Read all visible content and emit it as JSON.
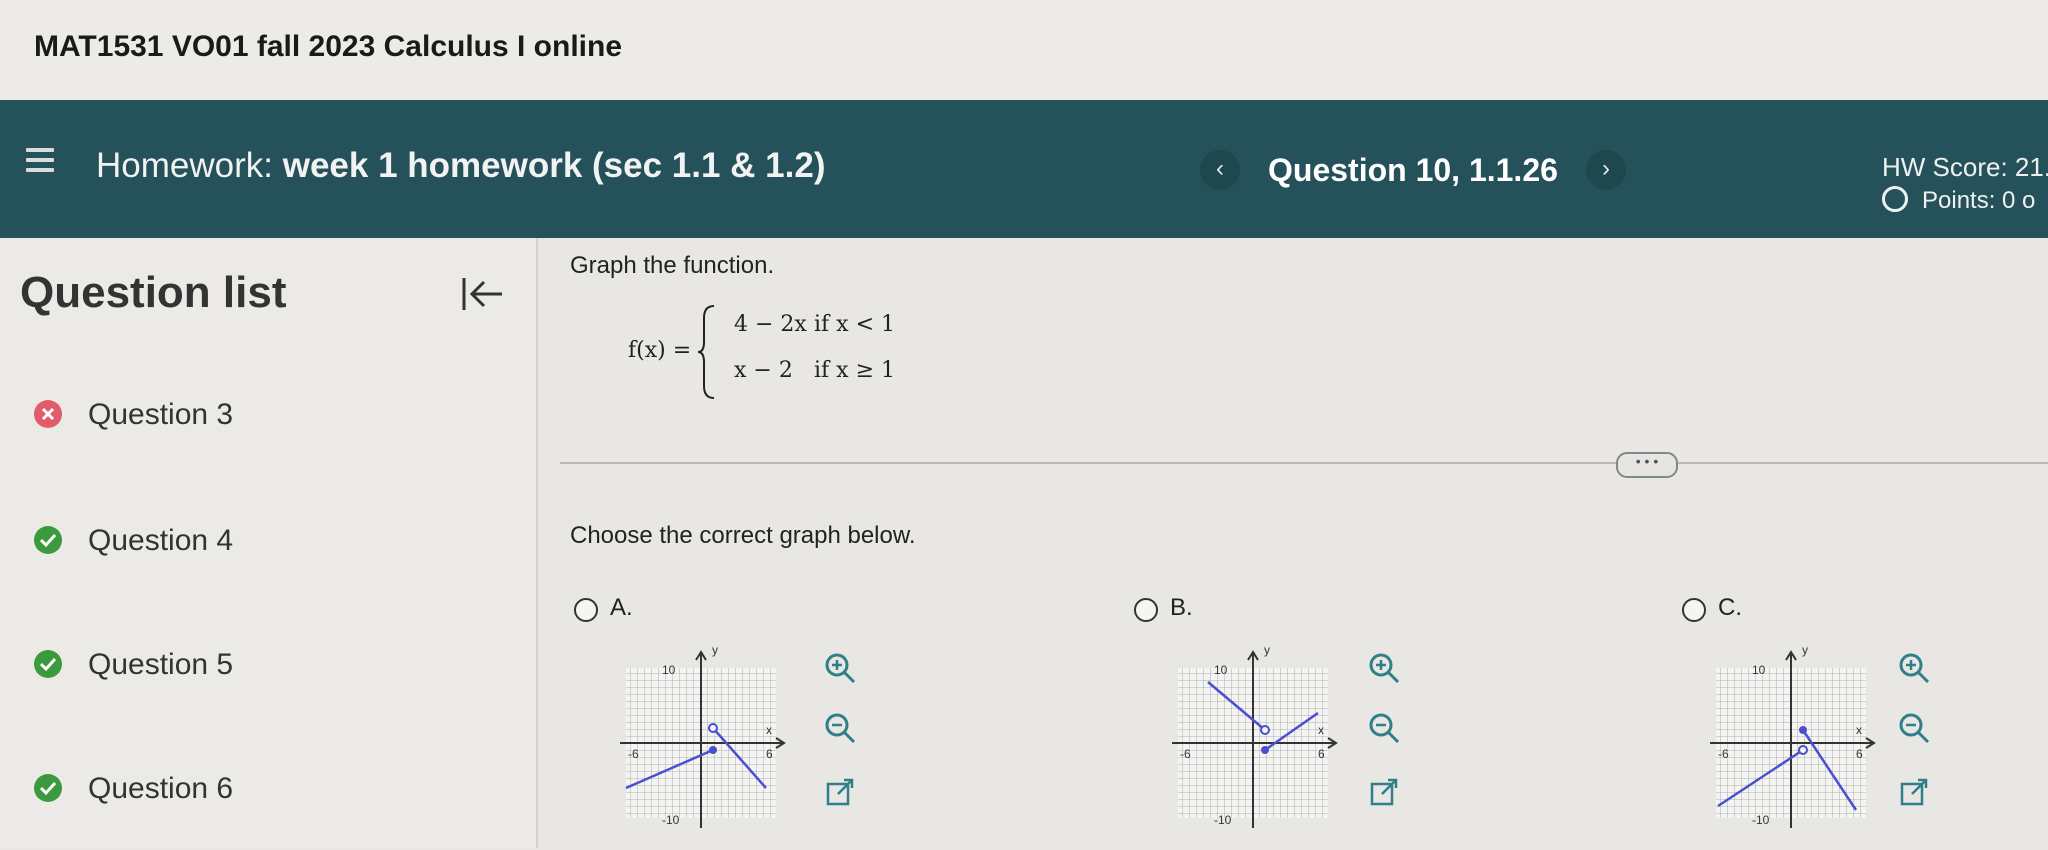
{
  "header": {
    "course_title": "MAT1531 VO01 fall 2023 Calculus I online"
  },
  "hwbar": {
    "homework_prefix": "Homework:",
    "homework_title": "week 1 homework (sec 1.1 & 1.2)",
    "prev_label": "‹",
    "question_id": "Question 10, 1.1.26",
    "next_label": "›",
    "hw_score": "HW Score: 21.",
    "points": "Points: 0 o"
  },
  "sidebar": {
    "title": "Question list",
    "items": [
      {
        "label": "Question 3",
        "status": "incorrect"
      },
      {
        "label": "Question 4",
        "status": "correct"
      },
      {
        "label": "Question 5",
        "status": "correct"
      },
      {
        "label": "Question 6",
        "status": "correct"
      }
    ]
  },
  "question": {
    "prompt": "Graph the function.",
    "formula": {
      "lhs": "f(x) =",
      "case1_expr": "4 − 2x",
      "case1_cond": "if  x < 1",
      "case2_expr": "x − 2",
      "case2_cond": "if  x ≥ 1"
    },
    "more_label": "• • •",
    "choose": "Choose the correct graph below.",
    "options": [
      {
        "letter": "A."
      },
      {
        "letter": "B."
      },
      {
        "letter": "C."
      }
    ],
    "graph_labels": {
      "y": "y",
      "x": "x",
      "ymax": "10",
      "ymin": "-10",
      "xmin": "-6",
      "xmax": "6"
    }
  },
  "colors": {
    "hw_bar": "#25525a",
    "correct": "#3c9a3e",
    "incorrect": "#e05b6b",
    "graph_line": "#4a4fd0"
  }
}
